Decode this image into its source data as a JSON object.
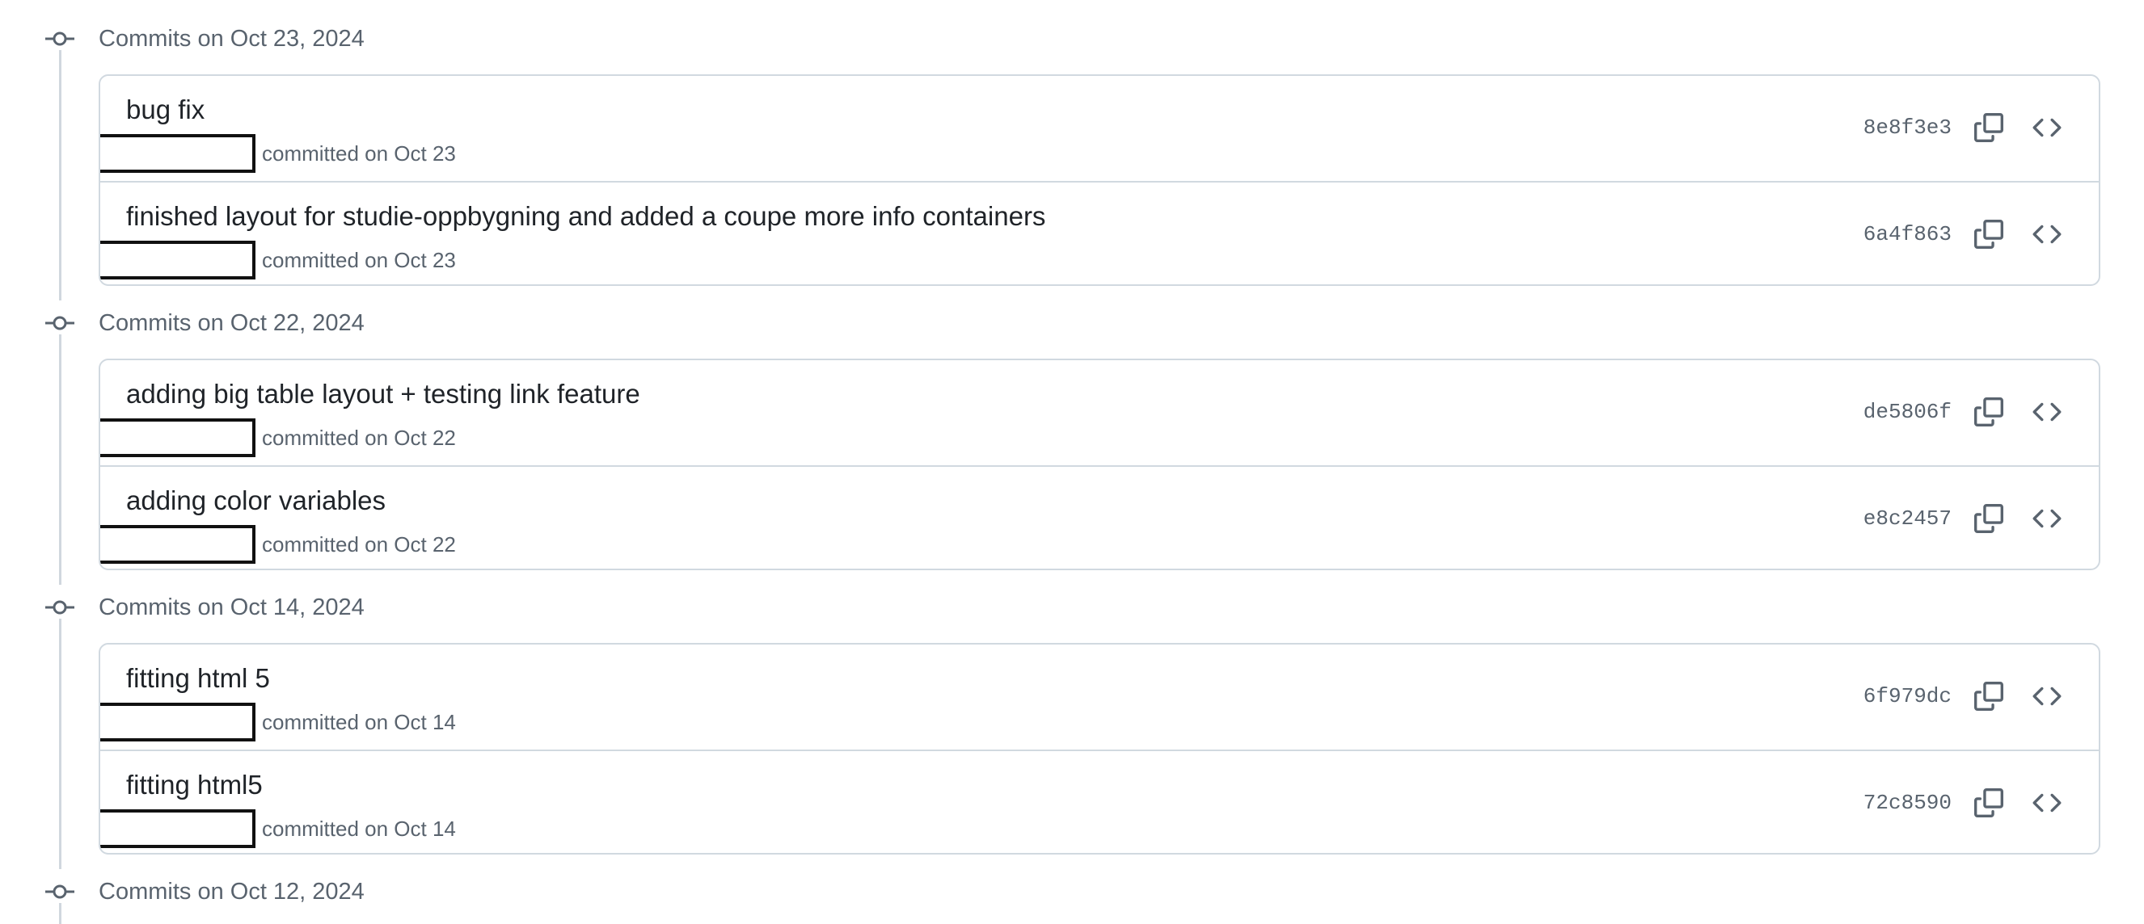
{
  "groups": [
    {
      "date_label": "Commits on Oct 23, 2024",
      "commits": [
        {
          "title": "bug fix",
          "meta": "committed on Oct 23",
          "sha": "8e8f3e3"
        },
        {
          "title": "finished layout for studie-oppbygning and added a coupe more info containers",
          "meta": "committed on Oct 23",
          "sha": "6a4f863"
        }
      ]
    },
    {
      "date_label": "Commits on Oct 22, 2024",
      "commits": [
        {
          "title": "adding big table layout + testing link feature",
          "meta": "committed on Oct 22",
          "sha": "de5806f"
        },
        {
          "title": "adding color variables",
          "meta": "committed on Oct 22",
          "sha": "e8c2457"
        }
      ]
    },
    {
      "date_label": "Commits on Oct 14, 2024",
      "commits": [
        {
          "title": "fitting html 5",
          "meta": "committed on Oct 14",
          "sha": "6f979dc"
        },
        {
          "title": "fitting html5",
          "meta": "committed on Oct 14",
          "sha": "72c8590"
        }
      ]
    },
    {
      "date_label": "Commits on Oct 12, 2024",
      "commits": []
    }
  ],
  "icons": {
    "group": "git-commit-icon",
    "copy": "copy-icon",
    "browse": "code-icon"
  },
  "colors": {
    "text": "#1f2328",
    "muted": "#59636e",
    "border": "#d1d9e0",
    "timeline": "#d0d7de"
  }
}
